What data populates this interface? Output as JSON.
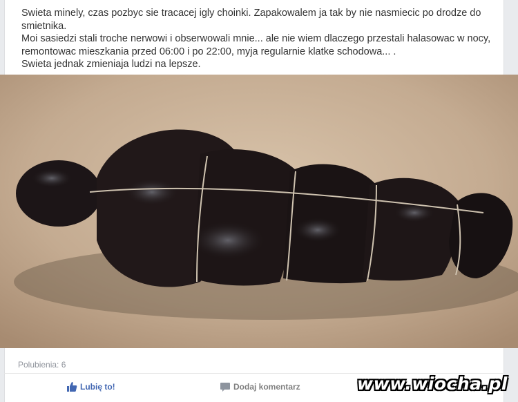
{
  "post": {
    "lines": [
      "Swieta minely, czas pozbyc sie tracacej igly choinki. Zapakowalem ja tak by nie nasmiecic po drodze do",
      "smietnika.",
      "Moi sasiedzi stali troche nerwowi i obserwowali mnie... ale nie wiem dlaczego przestali halasowac w nocy,",
      "remontowac mieszkania przed 06:00 i po 22:00, myja regularnie klatke schodowa... .",
      "Swieta jednak zmieniaja ludzi na lepsze."
    ]
  },
  "footer": {
    "likes_count": "Polubienia: 6",
    "like_label": "Lubię to!",
    "comment_label": "Dodaj komentarz"
  },
  "watermark": "www.wiocha.pl",
  "colors": {
    "accent": "#4267b2",
    "muted": "#90949c",
    "text": "#333333"
  }
}
